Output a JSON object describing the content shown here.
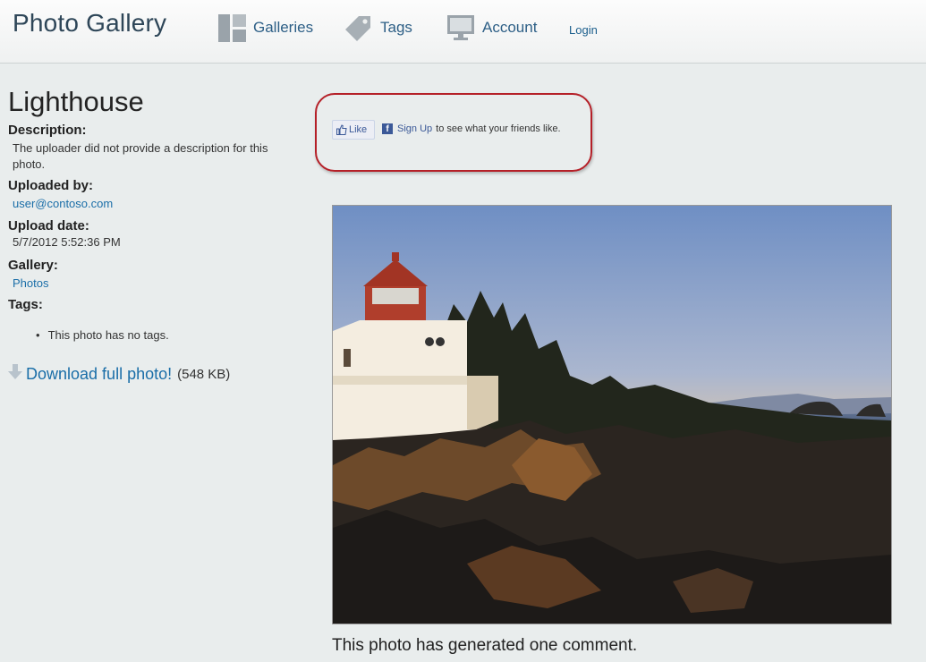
{
  "header": {
    "site_title": "Photo Gallery",
    "nav": {
      "galleries": "Galleries",
      "tags": "Tags",
      "account": "Account",
      "login": "Login"
    }
  },
  "photo": {
    "title": "Lighthouse",
    "description_label": "Description:",
    "description_text": "The uploader did not provide a description for this photo.",
    "uploaded_by_label": "Uploaded by:",
    "uploaded_by_value": "user@contoso.com",
    "upload_date_label": "Upload date:",
    "upload_date_value": "5/7/2012 5:52:36 PM",
    "gallery_label": "Gallery:",
    "gallery_value": "Photos",
    "tags_label": "Tags:",
    "tags_empty": "This photo has no tags.",
    "download_label": "Download full photo!",
    "download_size": "(548 KB)",
    "comment_count_text": "This photo has generated one comment."
  },
  "facebook": {
    "like_label": "Like",
    "signup_label": "Sign Up",
    "signup_suffix": "to see what your friends like."
  },
  "icons": {
    "galleries": "galleries-icon",
    "tags": "tag-icon",
    "account": "monitor-icon",
    "download": "download-arrow-icon",
    "like": "thumbs-up-icon",
    "facebook": "facebook-icon"
  },
  "colors": {
    "link": "#1a6ea8",
    "highlight_border": "#b52028",
    "facebook": "#3b5998"
  }
}
